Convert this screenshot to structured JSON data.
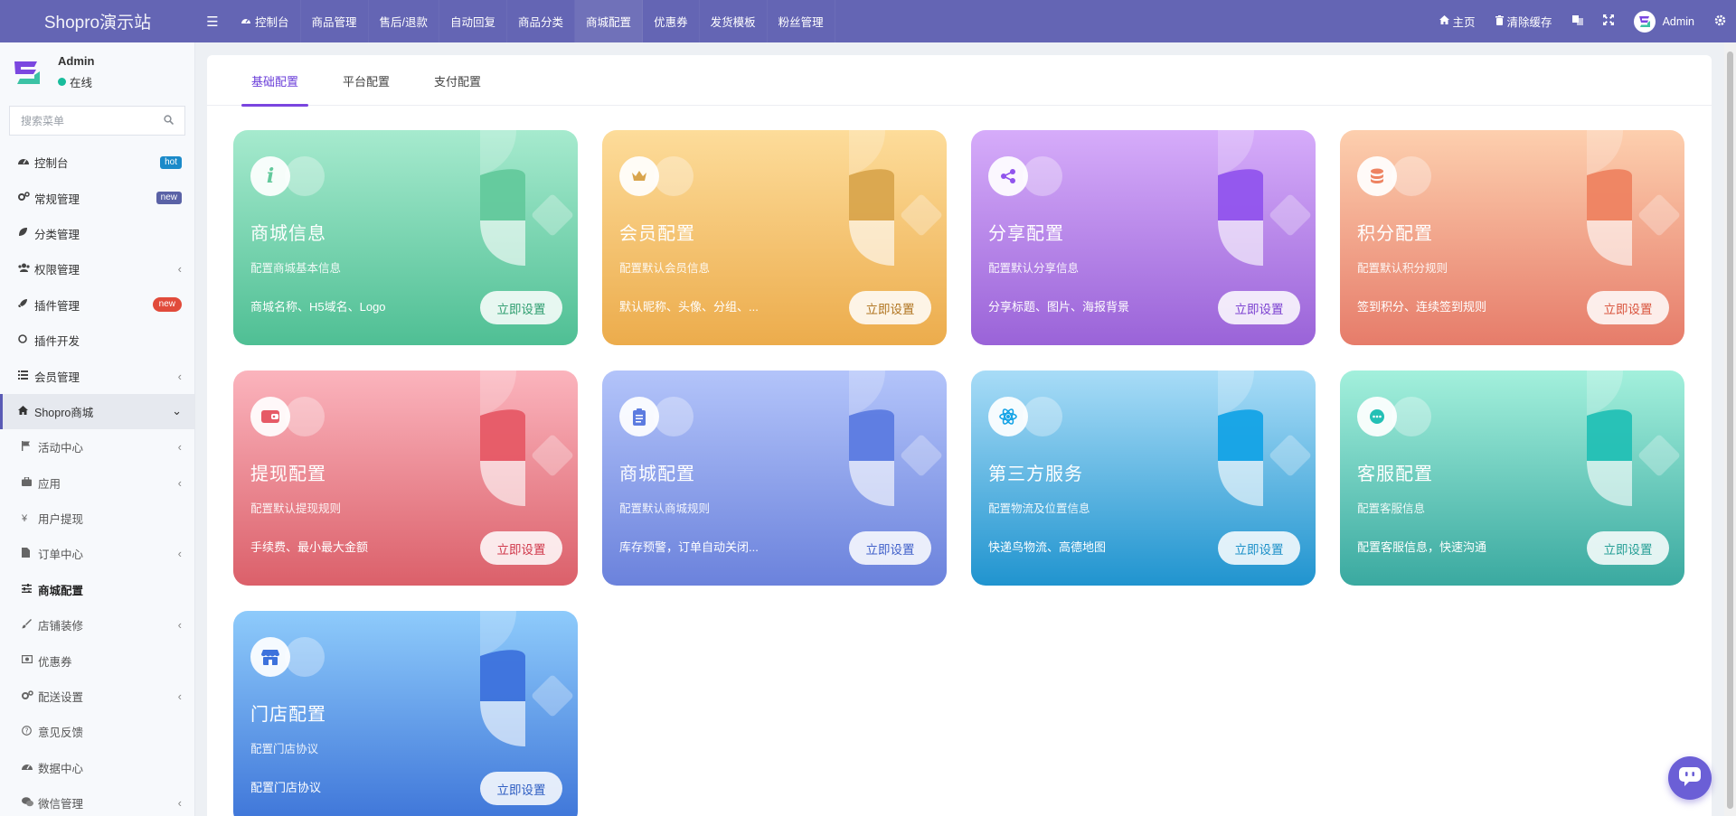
{
  "app": {
    "title": "Shopro演示站"
  },
  "topnav": {
    "items": [
      {
        "label": "控制台",
        "icon": "dashboard-icon"
      },
      {
        "label": "商品管理"
      },
      {
        "label": "售后/退款"
      },
      {
        "label": "自动回复"
      },
      {
        "label": "商品分类"
      },
      {
        "label": "商城配置"
      },
      {
        "label": "优惠券"
      },
      {
        "label": "发货模板"
      },
      {
        "label": "粉丝管理"
      }
    ],
    "right": {
      "home_label": "主页",
      "clear_cache_label": "清除缓存",
      "user_name": "Admin"
    }
  },
  "sidebar": {
    "user": {
      "name": "Admin",
      "status": "在线"
    },
    "search_placeholder": "搜索菜单",
    "items": [
      {
        "label": "控制台",
        "icon": "dashboard-icon",
        "badge": "hot"
      },
      {
        "label": "常规管理",
        "icon": "cogs-icon",
        "badge": "new"
      },
      {
        "label": "分类管理",
        "icon": "leaf-icon"
      },
      {
        "label": "权限管理",
        "icon": "users-icon"
      },
      {
        "label": "插件管理",
        "icon": "rocket-icon",
        "badge": "new"
      },
      {
        "label": "插件开发",
        "icon": "circle-icon"
      },
      {
        "label": "会员管理",
        "icon": "list-icon"
      },
      {
        "label": "Shopro商城",
        "icon": "home-icon"
      },
      {
        "label": "活动中心",
        "icon": "flag-icon"
      },
      {
        "label": "应用",
        "icon": "briefcase-icon"
      },
      {
        "label": "用户提现",
        "icon": "yen-icon"
      },
      {
        "label": "订单中心",
        "icon": "file-icon"
      },
      {
        "label": "商城配置",
        "icon": "sliders-icon"
      },
      {
        "label": "店铺装修",
        "icon": "brush-icon"
      },
      {
        "label": "优惠券",
        "icon": "money-icon"
      },
      {
        "label": "配送设置",
        "icon": "cogs-icon"
      },
      {
        "label": "意见反馈",
        "icon": "question-icon"
      },
      {
        "label": "数据中心",
        "icon": "dashboard-icon"
      },
      {
        "label": "微信管理",
        "icon": "wechat-icon"
      }
    ]
  },
  "tabs": [
    {
      "label": "基础配置"
    },
    {
      "label": "平台配置"
    },
    {
      "label": "支付配置"
    }
  ],
  "cards": [
    {
      "title": "商城信息",
      "subtitle": "配置商城基本信息",
      "desc": "商城名称、H5域名、Logo",
      "button": "立即设置",
      "icon": "info-icon",
      "colors": {
        "top": "#a6eace",
        "bottom": "#4fbf94",
        "deco": "#63c99c",
        "btn_text": "#2e9d6f"
      }
    },
    {
      "title": "会员配置",
      "subtitle": "配置默认会员信息",
      "desc": "默认昵称、头像、分组、...",
      "button": "立即设置",
      "icon": "crown-icon",
      "colors": {
        "top": "#fddc9a",
        "bottom": "#ecac4c",
        "deco": "#d9a54d",
        "btn_text": "#b07420"
      }
    },
    {
      "title": "分享配置",
      "subtitle": "配置默认分享信息",
      "desc": "分享标题、图片、海报背景",
      "button": "立即设置",
      "icon": "share-icon",
      "colors": {
        "top": "#d6acfa",
        "bottom": "#9a63d8",
        "deco": "#9154ed",
        "btn_text": "#7a3fd0"
      }
    },
    {
      "title": "积分配置",
      "subtitle": "配置默认积分规则",
      "desc": "签到积分、连续签到规则",
      "button": "立即设置",
      "icon": "database-icon",
      "colors": {
        "top": "#fdcfae",
        "bottom": "#e67c6a",
        "deco": "#ee8361",
        "btn_text": "#d9533c"
      }
    },
    {
      "title": "提现配置",
      "subtitle": "配置默认提现规则",
      "desc": "手续费、最小最大金额",
      "button": "立即设置",
      "icon": "wallet-icon",
      "colors": {
        "top": "#fbb4bd",
        "bottom": "#db606a",
        "deco": "#e65a66",
        "btn_text": "#d0384a"
      }
    },
    {
      "title": "商城配置",
      "subtitle": "配置默认商城规则",
      "desc": "库存预警，订单自动关闭...",
      "button": "立即设置",
      "icon": "clipboard-icon",
      "colors": {
        "top": "#b3c4fa",
        "bottom": "#6b82dc",
        "deco": "#5c7be0",
        "btn_text": "#3f5fc9"
      }
    },
    {
      "title": "第三方服务",
      "subtitle": "配置物流及位置信息",
      "desc": "快递鸟物流、高德地图",
      "button": "立即设置",
      "icon": "atom-icon",
      "colors": {
        "top": "#a8dcf7",
        "bottom": "#2094cf",
        "deco": "#14a3e6",
        "btn_text": "#1a8fc8"
      }
    },
    {
      "title": "客服配置",
      "subtitle": "配置客服信息",
      "desc": "配置客服信息，快速沟通",
      "button": "立即设置",
      "icon": "chat-icon",
      "colors": {
        "top": "#a3f0dc",
        "bottom": "#3aa9a0",
        "deco": "#23c0b5",
        "btn_text": "#249e95"
      }
    },
    {
      "title": "门店配置",
      "subtitle": "配置门店协议",
      "desc": "配置门店协议",
      "button": "立即设置",
      "icon": "store-icon",
      "colors": {
        "top": "#8ecbfb",
        "bottom": "#3d74d8",
        "deco": "#3d72dc",
        "btn_text": "#2d5dc2"
      }
    }
  ]
}
